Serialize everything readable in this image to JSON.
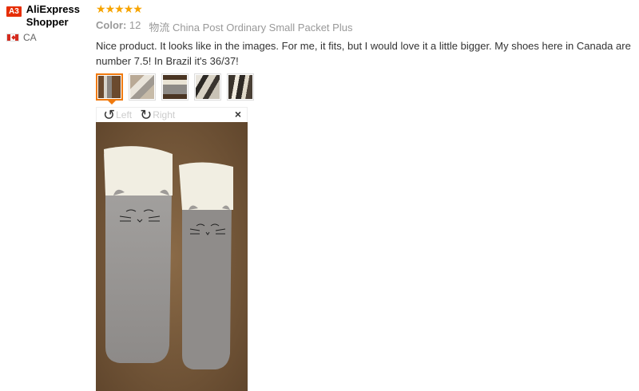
{
  "reviewer": {
    "badge": "A3",
    "name": "AliExpress Shopper",
    "country": "CA"
  },
  "review": {
    "rating": 5,
    "color_label": "Color:",
    "color_value": "12",
    "shipping_label": "物流",
    "shipping_value": "China Post Ordinary Small Packet Plus",
    "text": "Nice product. It looks like in the images. For me, it fits, but I would love it a little bigger. My shoes here in Canada are number 7.5! In Brazil it's 36/37!"
  },
  "viewer": {
    "rotate_left_label": "Left",
    "rotate_right_label": "Right",
    "close_symbol": "×",
    "selected_index": 0,
    "thumbnail_count": 5
  },
  "colors": {
    "star": "#f7a400",
    "badge": "#e62e04",
    "active_border": "#f07a0e"
  }
}
